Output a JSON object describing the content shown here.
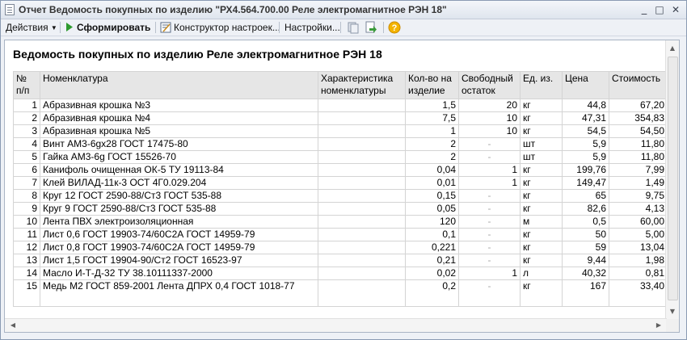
{
  "window": {
    "title": "Отчет Ведомость покупных по изделию \"РХ4.564.700.00 Реле электромагнитное РЭН 18\"",
    "minimize": "_",
    "maximize": "□",
    "close": "✕"
  },
  "toolbar": {
    "actions": "Действия",
    "generate": "Сформировать",
    "constructor": "Конструктор настроек...",
    "settings": "Настройки..."
  },
  "report": {
    "title": "Ведомость покупных по изделию Реле электромагнитное РЭН 18",
    "headers": [
      "№ п/п",
      "Номенклатура",
      "Характеристика номенклатуры",
      "Кол-во на изделие",
      "Свободный остаток",
      "Ед. из.",
      "Цена",
      "Стоимость"
    ],
    "rows": [
      {
        "n": "1",
        "name": "Абразивная крошка №3",
        "char": "",
        "qty": "1,5",
        "free": "20",
        "unit": "кг",
        "price": "44,8",
        "cost": "67,20"
      },
      {
        "n": "2",
        "name": "Абразивная крошка №4",
        "char": "",
        "qty": "7,5",
        "free": "10",
        "unit": "кг",
        "price": "47,31",
        "cost": "354,83"
      },
      {
        "n": "3",
        "name": "Абразивная крошка №5",
        "char": "",
        "qty": "1",
        "free": "10",
        "unit": "кг",
        "price": "54,5",
        "cost": "54,50"
      },
      {
        "n": "4",
        "name": "Винт АМ3-6gx28 ГОСТ 17475-80",
        "char": "",
        "qty": "2",
        "free": "-",
        "unit": "шт",
        "price": "5,9",
        "cost": "11,80"
      },
      {
        "n": "5",
        "name": "Гайка АМ3-6g ГОСТ 15526-70",
        "char": "",
        "qty": "2",
        "free": "-",
        "unit": "шт",
        "price": "5,9",
        "cost": "11,80"
      },
      {
        "n": "6",
        "name": "Канифоль очищенная ОК-5 ТУ 19113-84",
        "char": "",
        "qty": "0,04",
        "free": "1",
        "unit": "кг",
        "price": "199,76",
        "cost": "7,99"
      },
      {
        "n": "7",
        "name": "Клей ВИЛАД-11к-3 ОСТ 4Г0.029.204",
        "char": "",
        "qty": "0,01",
        "free": "1",
        "unit": "кг",
        "price": "149,47",
        "cost": "1,49"
      },
      {
        "n": "8",
        "name": "Круг 12 ГОСТ 2590-88/Ст3 ГОСТ 535-88",
        "char": "",
        "qty": "0,15",
        "free": "-",
        "unit": "кг",
        "price": "65",
        "cost": "9,75"
      },
      {
        "n": "9",
        "name": "Круг 9 ГОСТ 2590-88/Ст3 ГОСТ 535-88",
        "char": "",
        "qty": "0,05",
        "free": "-",
        "unit": "кг",
        "price": "82,6",
        "cost": "4,13"
      },
      {
        "n": "10",
        "name": "Лента ПВХ электроизоляционная",
        "char": "",
        "qty": "120",
        "free": "-",
        "unit": "м",
        "price": "0,5",
        "cost": "60,00"
      },
      {
        "n": "11",
        "name": "Лист 0,6 ГОСТ 19903-74/60С2А ГОСТ 14959-79",
        "char": "",
        "qty": "0,1",
        "free": "-",
        "unit": "кг",
        "price": "50",
        "cost": "5,00"
      },
      {
        "n": "12",
        "name": "Лист 0,8 ГОСТ 19903-74/60С2А ГОСТ 14959-79",
        "char": "",
        "qty": "0,221",
        "free": "-",
        "unit": "кг",
        "price": "59",
        "cost": "13,04"
      },
      {
        "n": "13",
        "name": "Лист 1,5 ГОСТ 19904-90/Ст2 ГОСТ 16523-97",
        "char": "",
        "qty": "0,21",
        "free": "-",
        "unit": "кг",
        "price": "9,44",
        "cost": "1,98"
      },
      {
        "n": "14",
        "name": "Масло И-Т-Д-32 ТУ 38.10111337-2000",
        "char": "",
        "qty": "0,02",
        "free": "1",
        "unit": "л",
        "price": "40,32",
        "cost": "0,81"
      },
      {
        "n": "15",
        "name": "Медь М2 ГОСТ 859-2001 Лента ДПРХ 0,4 ГОСТ 1018-77",
        "char": "",
        "qty": "0,2",
        "free": "-",
        "unit": "кг",
        "price": "167",
        "cost": "33,40"
      }
    ]
  },
  "colors": {
    "header_bg": "#e6e6e6",
    "grid_line": "#d4d4d4",
    "window_bg": "#eef1f6",
    "generate_icon": "#2e9a2e",
    "help_icon": "#e8a400"
  },
  "icons": {
    "app": "document-icon",
    "generate": "play-icon",
    "constructor": "settings-constructor-icon",
    "copy": "copy-icon",
    "export": "export-icon",
    "help": "help-icon"
  }
}
